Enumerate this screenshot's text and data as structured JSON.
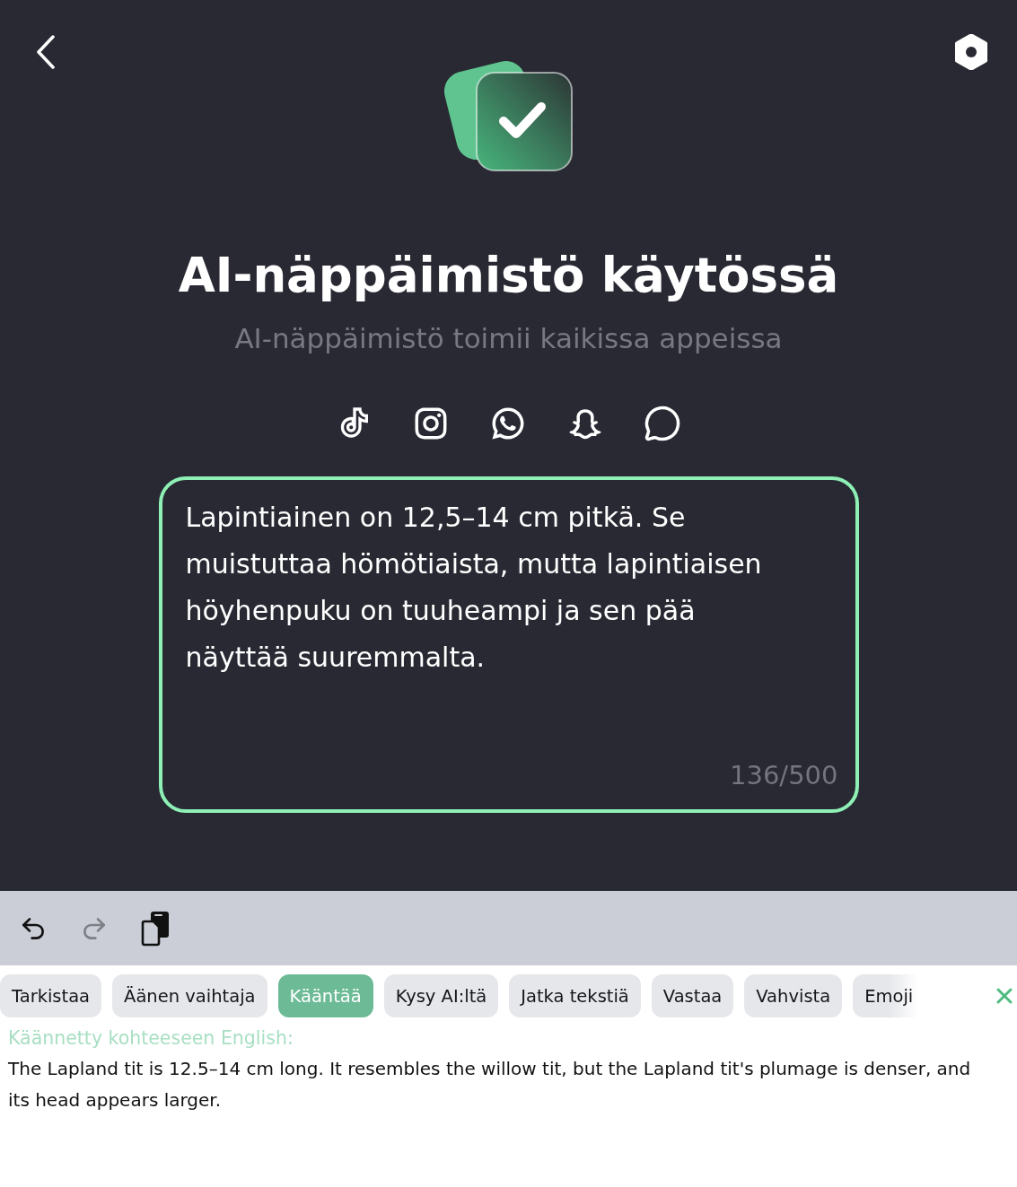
{
  "title": "AI-näppäimistö käytössä",
  "subtitle": "AI-näppäimistö toimii kaikissa appeissa",
  "text_field": {
    "value": "Lapintiainen on 12,5–14 cm pitkä. Se muistuttaa hömötiaista, mutta lapintiaisen höyhenpuku on tuuheampi ja sen pää näyttää suuremmalta.",
    "counter": "136/500"
  },
  "toolbar": [
    {
      "kind": "undo",
      "disabled": false
    },
    {
      "kind": "redo",
      "disabled": true
    },
    {
      "kind": "copy",
      "disabled": false
    }
  ],
  "actions": [
    {
      "label": "Tarkistaa",
      "selected": false
    },
    {
      "label": "Äänen vaihtaja",
      "selected": false
    },
    {
      "label": "Kääntää",
      "selected": true
    },
    {
      "label": "Kysy AI:ltä",
      "selected": false
    },
    {
      "label": "Jatka tekstiä",
      "selected": false
    },
    {
      "label": "Vastaa",
      "selected": false
    },
    {
      "label": "Vahvista",
      "selected": false
    },
    {
      "label": "Emoji",
      "selected": false
    }
  ],
  "result": {
    "heading": "Käännetty kohteeseen English:",
    "text": "The Lapland tit is 12.5–14 cm long. It resembles the willow tit, but the Lapland tit's plumage is denser, and its head appears larger."
  }
}
